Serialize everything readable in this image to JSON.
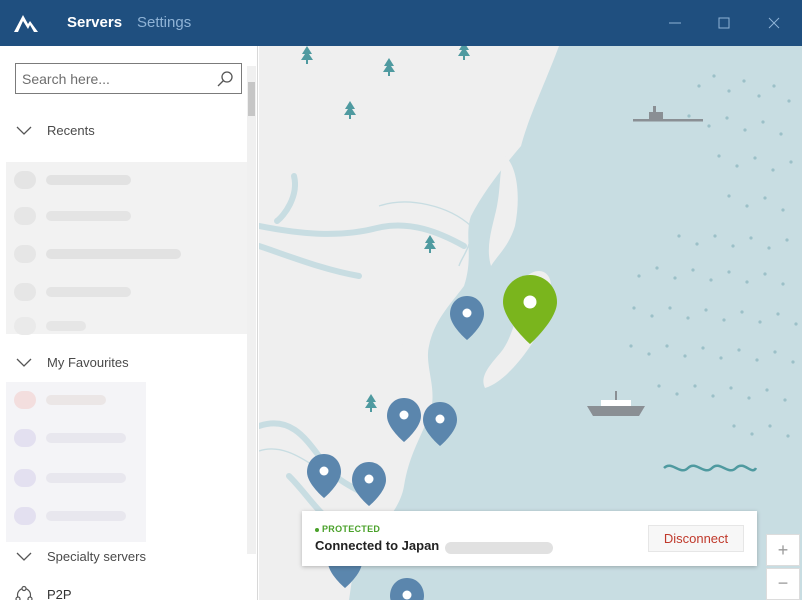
{
  "app": {
    "tabs": [
      {
        "label": "Servers",
        "active": true
      },
      {
        "label": "Settings",
        "active": false
      }
    ],
    "window_controls": [
      "minimize-icon",
      "maximize-icon",
      "close-icon"
    ]
  },
  "sidebar": {
    "search": {
      "placeholder": "Search here...",
      "value": ""
    },
    "sections": {
      "recents": "Recents",
      "favourites": "My Favourites",
      "specialty": "Specialty servers"
    },
    "specialty_items": [
      {
        "label": "P2P",
        "icon": "p2p-icon"
      }
    ]
  },
  "status": {
    "label": "PROTECTED",
    "text": "Connected to Japan",
    "disconnect_label": "Disconnect"
  },
  "zoom": {
    "in_label": "+",
    "out_label": "−"
  },
  "colors": {
    "titlebar": "#1f4f7f",
    "accent_green": "#7ab51d",
    "pin_blue": "#5b86ad",
    "land": "#efefef",
    "water": "#c8dde2",
    "protected": "#4aa12a",
    "disconnect": "#c0392b"
  }
}
